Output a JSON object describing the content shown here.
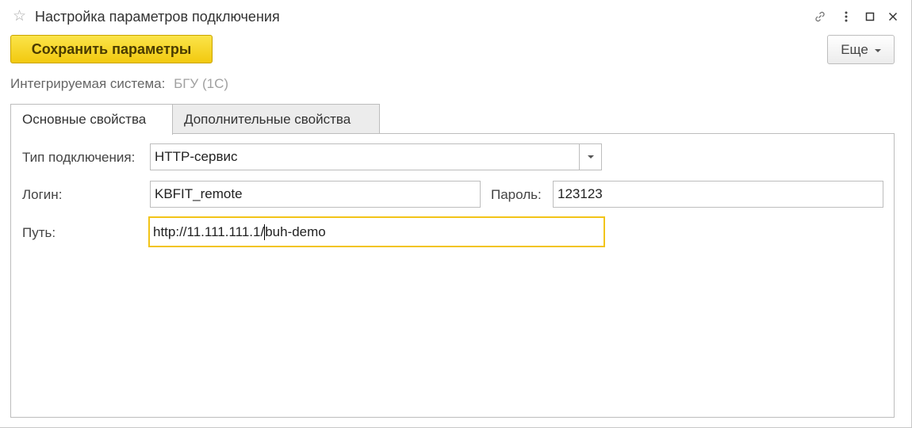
{
  "window": {
    "title": "Настройка параметров подключения"
  },
  "toolbar": {
    "save_label": "Сохранить параметры",
    "more_label": "Еще"
  },
  "system": {
    "label": "Интегрируемая система:",
    "value": "БГУ (1С)"
  },
  "tabs": [
    {
      "label": "Основные свойства",
      "active": true
    },
    {
      "label": "Дополнительные свойства",
      "active": false
    }
  ],
  "form": {
    "connection_type": {
      "label": "Тип подключения:",
      "value": "HTTP-сервис"
    },
    "login": {
      "label": "Логин:",
      "value": "KBFIT_remote"
    },
    "password": {
      "label": "Пароль:",
      "value": "123123"
    },
    "path": {
      "label": "Путь:",
      "value_before_cursor": "http://11.111.111.1/",
      "value_after_cursor": "buh-demo"
    }
  },
  "icons": {
    "favorite": "star-icon",
    "link": "link-icon",
    "menu": "more-vertical-icon",
    "maximize": "maximize-icon",
    "close": "close-icon"
  },
  "colors": {
    "accent_button": "#f5d327",
    "focus_border": "#f2c418"
  }
}
